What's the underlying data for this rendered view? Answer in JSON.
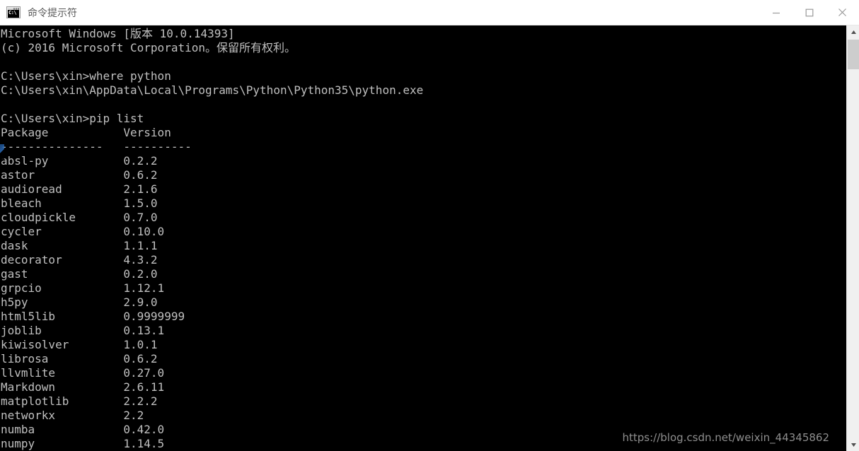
{
  "window": {
    "title": "命令提示符",
    "icon_name": "cmd-icon",
    "icon_glyph": "C:\\",
    "controls": {
      "minimize_label": "最小化",
      "maximize_label": "最大化",
      "close_label": "关闭"
    }
  },
  "console": {
    "foreground_color": "#c0c0c0",
    "background_color": "#000000",
    "header_lines": [
      "Microsoft Windows [版本 10.0.14393]",
      "(c) 2016 Microsoft Corporation。保留所有权利。",
      "",
      "C:\\Users\\xin>where python",
      "C:\\Users\\xin\\AppData\\Local\\Programs\\Python\\Python35\\python.exe",
      "",
      "C:\\Users\\xin>pip list"
    ],
    "table": {
      "columns": [
        "Package",
        "Version"
      ],
      "separator": [
        "---------------",
        "----------"
      ],
      "column_starts": [
        0,
        18
      ],
      "rows": [
        [
          "absl-py",
          "0.2.2"
        ],
        [
          "astor",
          "0.6.2"
        ],
        [
          "audioread",
          "2.1.6"
        ],
        [
          "bleach",
          "1.5.0"
        ],
        [
          "cloudpickle",
          "0.7.0"
        ],
        [
          "cycler",
          "0.10.0"
        ],
        [
          "dask",
          "1.1.1"
        ],
        [
          "decorator",
          "4.3.2"
        ],
        [
          "gast",
          "0.2.0"
        ],
        [
          "grpcio",
          "1.12.1"
        ],
        [
          "h5py",
          "2.9.0"
        ],
        [
          "html5lib",
          "0.9999999"
        ],
        [
          "joblib",
          "0.13.1"
        ],
        [
          "kiwisolver",
          "1.0.1"
        ],
        [
          "librosa",
          "0.6.2"
        ],
        [
          "llvmlite",
          "0.27.0"
        ],
        [
          "Markdown",
          "2.6.11"
        ],
        [
          "matplotlib",
          "2.2.2"
        ],
        [
          "networkx",
          "2.2"
        ],
        [
          "numba",
          "0.42.0"
        ],
        [
          "numpy",
          "1.14.5"
        ]
      ]
    }
  },
  "watermark": {
    "text": "https://blog.csdn.net/weixin_44345862"
  },
  "scrollbar": {
    "up_arrow": "▲",
    "down_arrow": "▼",
    "thumb_color": "#cdcdcd",
    "track_color": "#f0f0f0"
  }
}
